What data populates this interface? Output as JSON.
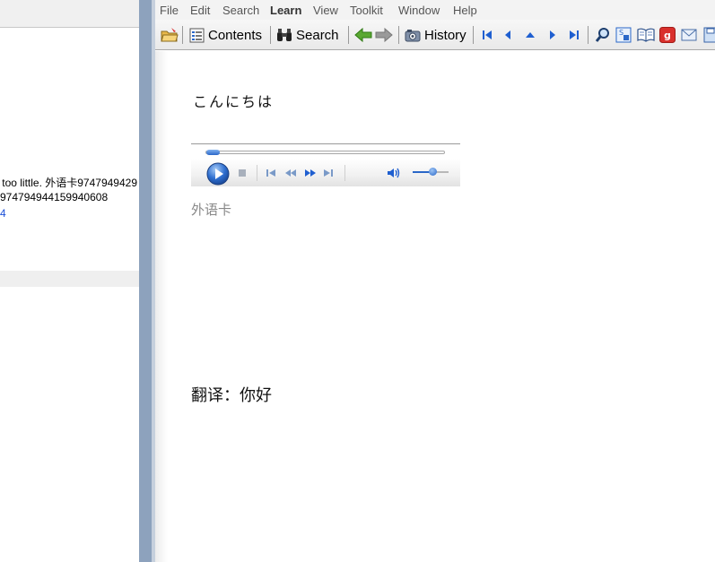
{
  "left_panel": {
    "lines": [
      "too little. 外语卡9747949429",
      "974794944159940608",
      "4"
    ]
  },
  "menu": [
    {
      "label": "File"
    },
    {
      "label": "Edit"
    },
    {
      "label": "Search"
    },
    {
      "label": "Learn"
    },
    {
      "label": "View"
    },
    {
      "label": "Toolkit"
    },
    {
      "label": "Window"
    },
    {
      "label": "Help"
    }
  ],
  "toolbar": {
    "contents_label": "Contents",
    "search_label": "Search",
    "history_label": "History"
  },
  "content": {
    "greeting": "こんにちは",
    "audio_caption": "外语卡",
    "translation": "翻译：你好"
  },
  "player": {
    "progress": 0.05,
    "volume": 0.55
  },
  "colors": {
    "splitter": "#8da2bd",
    "accent_blue": "#2a67c8"
  }
}
